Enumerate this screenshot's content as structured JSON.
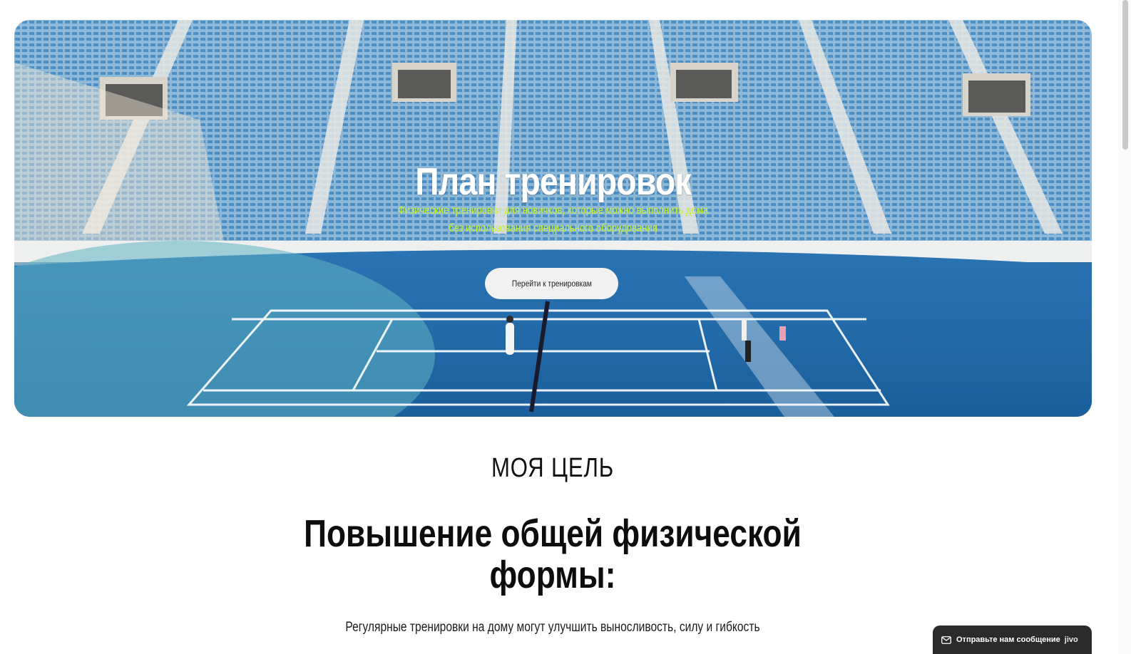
{
  "hero": {
    "title": "План тренировок",
    "subtitle_line1": "Физические тренировки для новичков, которые можно выполнить дома",
    "subtitle_line2": "без использования специального оборудования",
    "cta_label": "Перейти к тренировкам",
    "image_icon": "tennis-stadium-photo"
  },
  "goal": {
    "kicker": "МОЯ ЦЕЛЬ",
    "title_line1": "Повышение общей физической",
    "title_line2": "формы:",
    "text": "Регулярные тренировки на дому могут улучшить выносливость, силу и гибкость"
  },
  "chat": {
    "label": "Отправьте нам сообщение",
    "brand": "jivo",
    "icon": "mail-icon"
  },
  "colors": {
    "subtitle": "#c8f03a",
    "button_bg": "#f1f1f1",
    "chat_bg": "#2b2b2b"
  }
}
